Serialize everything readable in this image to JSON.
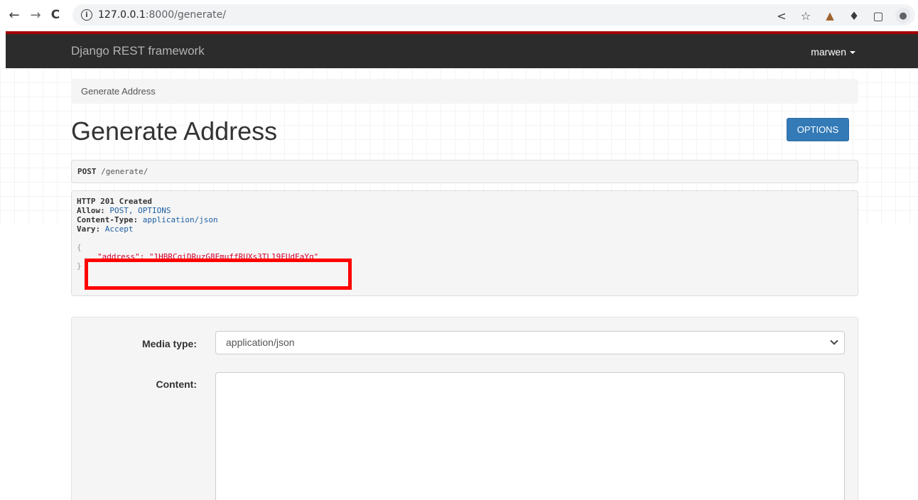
{
  "browser": {
    "url_host": "127.0.0.1",
    "url_rest": ":8000/generate/",
    "icons": [
      "back-icon",
      "forward-icon",
      "reload-icon",
      "info-icon",
      "share-icon",
      "star-icon",
      "extension-icon",
      "puzzle-icon",
      "sidepanel-icon",
      "profile-icon"
    ]
  },
  "navbar": {
    "brand": "Django REST framework",
    "user": "marwen"
  },
  "breadcrumb": {
    "item": "Generate Address"
  },
  "page": {
    "title": "Generate Address",
    "options_label": "OPTIONS"
  },
  "request": {
    "method": "POST",
    "path": "/generate/"
  },
  "response": {
    "status": "HTTP 201 Created",
    "headers": [
      {
        "key": "Allow:",
        "value": "POST, OPTIONS"
      },
      {
        "key": "Content-Type:",
        "value": "application/json"
      },
      {
        "key": "Vary:",
        "value": "Accept"
      }
    ],
    "open_brace": "{",
    "close_brace": "}",
    "json_line": "\"address\": \"1HBRCqiDRuzG8EmuffRUXs3TL19FUdEaYq\""
  },
  "form": {
    "media_type_label": "Media type:",
    "media_type_value": "application/json",
    "content_label": "Content:"
  },
  "colors": {
    "navbar_bg": "#2c2c2c",
    "navbar_accent": "#a30000",
    "button_primary": "#337ab7",
    "highlight": "#ff0000"
  }
}
